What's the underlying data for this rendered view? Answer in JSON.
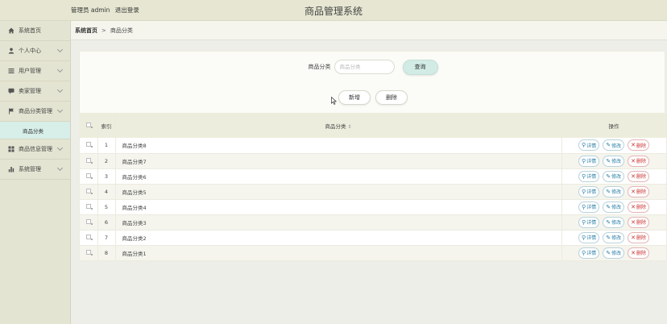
{
  "header": {
    "user_role": "管理员 admin",
    "logout": "退出登录",
    "app_title": "商品管理系统"
  },
  "sidebar": {
    "items": [
      {
        "label": "系统首页",
        "icon": "home-icon"
      },
      {
        "label": "个人中心",
        "icon": "user-icon"
      },
      {
        "label": "用户管理",
        "icon": "list-icon"
      },
      {
        "label": "卖家管理",
        "icon": "comment-icon"
      },
      {
        "label": "商品分类管理",
        "icon": "flag-icon"
      },
      {
        "label": "商品信息管理",
        "icon": "grid-icon"
      },
      {
        "label": "系统管理",
        "icon": "bar-chart-icon"
      }
    ],
    "active_sub": "商品分类"
  },
  "breadcrumb": {
    "home": "系统首页",
    "separator": ">",
    "current": "商品分类"
  },
  "search": {
    "label": "商品分类",
    "placeholder": "商品分类",
    "button": "查询"
  },
  "actions": {
    "add": "新增",
    "delete": "删除"
  },
  "table": {
    "index_header": "索引",
    "name_header": "商品分类",
    "sort_mark": "⇕",
    "op_header": "操作",
    "rows": [
      {
        "no": "1",
        "name": "商品分类8"
      },
      {
        "no": "2",
        "name": "商品分类7"
      },
      {
        "no": "3",
        "name": "商品分类6"
      },
      {
        "no": "4",
        "name": "商品分类5"
      },
      {
        "no": "5",
        "name": "商品分类4"
      },
      {
        "no": "6",
        "name": "商品分类3"
      },
      {
        "no": "7",
        "name": "商品分类2"
      },
      {
        "no": "8",
        "name": "商品分类1"
      }
    ],
    "row_actions": {
      "detail": "详情",
      "edit": "修改",
      "delete": "删除"
    }
  },
  "colors": {
    "topbar": "#e6e6d2",
    "sidebar": "#e4e4d2",
    "active_sub_bg": "#d7efe8",
    "query_button": "#d2ece5",
    "edit_accent": "#2a7fa8",
    "delete_accent": "#cc3333"
  }
}
